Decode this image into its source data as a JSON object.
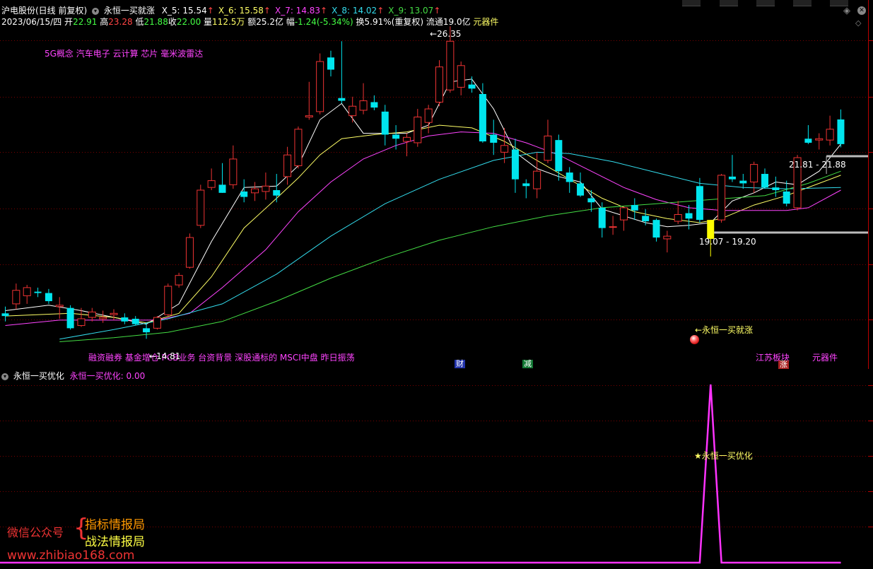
{
  "header": {
    "stock": "沪电股份(日线 前复权)",
    "indicator": "永恒一买就涨",
    "ma_items": [
      {
        "label": "X_5:",
        "value": "15.54",
        "color": "#ffffff"
      },
      {
        "label": "X_6:",
        "value": "15.58",
        "color": "#ffff66"
      },
      {
        "label": "X_7:",
        "value": "14.83",
        "color": "#ff44ff"
      },
      {
        "label": "X_8:",
        "value": "14.02",
        "color": "#33ddee"
      },
      {
        "label": "X_9:",
        "value": "13.07",
        "color": "#44dd44"
      }
    ],
    "up_arrow": "↑"
  },
  "quote": {
    "date": "2023/06/15/四",
    "open_label": "开",
    "open": "22.91",
    "high_label": "高",
    "high": "23.28",
    "low_label": "低",
    "low": "21.88",
    "close_label": "收",
    "close": "22.00",
    "vol_label": "量",
    "vol": "112.5万",
    "amt_label": "额",
    "amt": "25.2亿",
    "chg_label": "幅",
    "chg": "-1.24(-5.34%)",
    "turnover": "换5.91%(重复权)",
    "float": "流通19.0亿",
    "sector": "元器件"
  },
  "concepts_top": "5G概念 汽车电子 云计算 芯片 毫米波雷达",
  "concepts_bottom": "融资融券 基金增仓 PCB业务 台资背景 深股通标的 MSCI中盘 昨日振荡",
  "annotations": {
    "peak_price": "26.35",
    "low_price": "14.81",
    "buy_signal": "←永恒一买就涨",
    "range_high": "21.81 - 21.88",
    "range_low": "19.07 - 19.20",
    "sector_tag": "江苏板块",
    "sector_tag2": "元器件",
    "badge_cai": "财",
    "badge_jian": "减",
    "badge_zhang": "涨"
  },
  "sub": {
    "name": "永恒一买优化",
    "line_label": "永恒一买优化: 0.00",
    "signal_label": "★永恒一买优化"
  },
  "watermark": {
    "wechat": "微信公众号",
    "brace": "{",
    "line1": "指标情报局",
    "line2": "战法情报局",
    "url": "www.zhibiao168.com"
  },
  "colors": {
    "up": "#ee3333",
    "down": "#00e5ee",
    "signal_bar": "#ffff00",
    "ma5": "#ffffff",
    "ma6": "#ffff66",
    "ma7": "#ff44ff",
    "ma8": "#33ddee",
    "ma9": "#44dd44",
    "sub_line": "#ff33ff",
    "grid": "#7a0000"
  },
  "chart_data": {
    "type": "candlestick",
    "y_range": [
      13.8,
      26.8
    ],
    "candles": [
      {
        "o": 15.75,
        "h": 16.0,
        "l": 15.45,
        "c": 15.65
      },
      {
        "o": 16.1,
        "h": 16.85,
        "l": 15.9,
        "c": 16.6
      },
      {
        "o": 16.4,
        "h": 16.8,
        "l": 16.1,
        "c": 16.7
      },
      {
        "o": 16.55,
        "h": 16.7,
        "l": 16.35,
        "c": 16.5
      },
      {
        "o": 16.5,
        "h": 16.65,
        "l": 16.1,
        "c": 16.2
      },
      {
        "o": 16.0,
        "h": 16.35,
        "l": 15.55,
        "c": 16.05
      },
      {
        "o": 15.95,
        "h": 16.05,
        "l": 15.15,
        "c": 15.2
      },
      {
        "o": 15.3,
        "h": 15.95,
        "l": 15.25,
        "c": 15.55
      },
      {
        "o": 15.6,
        "h": 15.95,
        "l": 15.45,
        "c": 15.8
      },
      {
        "o": 15.55,
        "h": 15.85,
        "l": 15.4,
        "c": 15.6
      },
      {
        "o": 15.7,
        "h": 15.9,
        "l": 15.5,
        "c": 15.75
      },
      {
        "o": 15.6,
        "h": 15.75,
        "l": 15.35,
        "c": 15.45
      },
      {
        "o": 15.55,
        "h": 15.65,
        "l": 15.3,
        "c": 15.35
      },
      {
        "o": 15.2,
        "h": 15.4,
        "l": 14.81,
        "c": 15.05
      },
      {
        "o": 15.2,
        "h": 15.65,
        "l": 15.15,
        "c": 15.6
      },
      {
        "o": 15.7,
        "h": 16.85,
        "l": 15.65,
        "c": 16.75
      },
      {
        "o": 16.8,
        "h": 17.25,
        "l": 16.7,
        "c": 17.15
      },
      {
        "o": 17.45,
        "h": 18.7,
        "l": 17.4,
        "c": 18.55
      },
      {
        "o": 19.0,
        "h": 20.5,
        "l": 18.9,
        "c": 20.3
      },
      {
        "o": 20.4,
        "h": 21.1,
        "l": 20.3,
        "c": 20.65
      },
      {
        "o": 20.5,
        "h": 21.3,
        "l": 20.2,
        "c": 20.2
      },
      {
        "o": 20.5,
        "h": 21.95,
        "l": 20.35,
        "c": 21.45
      },
      {
        "o": 20.25,
        "h": 20.7,
        "l": 19.85,
        "c": 20.05
      },
      {
        "o": 20.2,
        "h": 20.6,
        "l": 19.9,
        "c": 20.35
      },
      {
        "o": 20.25,
        "h": 20.95,
        "l": 19.95,
        "c": 20.45
      },
      {
        "o": 20.3,
        "h": 20.9,
        "l": 19.85,
        "c": 20.1
      },
      {
        "o": 20.8,
        "h": 21.9,
        "l": 20.5,
        "c": 21.6
      },
      {
        "o": 21.2,
        "h": 22.65,
        "l": 21.1,
        "c": 22.55
      },
      {
        "o": 23.0,
        "h": 24.3,
        "l": 22.9,
        "c": 23.05
      },
      {
        "o": 23.2,
        "h": 25.35,
        "l": 23.1,
        "c": 25.05
      },
      {
        "o": 25.2,
        "h": 25.45,
        "l": 24.5,
        "c": 24.75
      },
      {
        "o": 23.7,
        "h": 25.8,
        "l": 23.5,
        "c": 23.6
      },
      {
        "o": 23.05,
        "h": 23.75,
        "l": 22.8,
        "c": 23.4
      },
      {
        "o": 23.25,
        "h": 24.25,
        "l": 23.1,
        "c": 23.6
      },
      {
        "o": 23.55,
        "h": 23.8,
        "l": 23.25,
        "c": 23.35
      },
      {
        "o": 23.2,
        "h": 23.45,
        "l": 21.95,
        "c": 22.35
      },
      {
        "o": 22.35,
        "h": 22.7,
        "l": 21.8,
        "c": 22.2
      },
      {
        "o": 22.1,
        "h": 22.4,
        "l": 21.55,
        "c": 22.25
      },
      {
        "o": 22.05,
        "h": 23.3,
        "l": 21.9,
        "c": 23.0
      },
      {
        "o": 22.8,
        "h": 23.45,
        "l": 22.4,
        "c": 23.3
      },
      {
        "o": 23.55,
        "h": 25.1,
        "l": 23.4,
        "c": 24.85
      },
      {
        "o": 24.0,
        "h": 26.35,
        "l": 23.9,
        "c": 25.8
      },
      {
        "o": 24.1,
        "h": 25.05,
        "l": 23.8,
        "c": 24.9
      },
      {
        "o": 24.2,
        "h": 24.5,
        "l": 23.9,
        "c": 24.05
      },
      {
        "o": 23.85,
        "h": 24.25,
        "l": 22.05,
        "c": 22.1
      },
      {
        "o": 22.35,
        "h": 22.9,
        "l": 21.6,
        "c": 22.05
      },
      {
        "o": 21.7,
        "h": 22.6,
        "l": 21.3,
        "c": 21.95
      },
      {
        "o": 21.8,
        "h": 22.2,
        "l": 20.2,
        "c": 20.7
      },
      {
        "o": 20.55,
        "h": 20.7,
        "l": 20.0,
        "c": 20.45
      },
      {
        "o": 20.35,
        "h": 21.7,
        "l": 20.0,
        "c": 21.0
      },
      {
        "o": 21.4,
        "h": 22.9,
        "l": 21.3,
        "c": 22.3
      },
      {
        "o": 22.15,
        "h": 22.35,
        "l": 20.65,
        "c": 21.0
      },
      {
        "o": 20.95,
        "h": 21.15,
        "l": 20.2,
        "c": 20.6
      },
      {
        "o": 20.55,
        "h": 20.95,
        "l": 20.05,
        "c": 20.1
      },
      {
        "o": 20.0,
        "h": 20.3,
        "l": 19.5,
        "c": 19.85
      },
      {
        "o": 19.65,
        "h": 19.85,
        "l": 18.55,
        "c": 18.9
      },
      {
        "o": 18.95,
        "h": 19.35,
        "l": 18.65,
        "c": 18.95
      },
      {
        "o": 19.2,
        "h": 19.7,
        "l": 18.8,
        "c": 19.65
      },
      {
        "o": 19.75,
        "h": 20.0,
        "l": 19.2,
        "c": 19.55
      },
      {
        "o": 19.35,
        "h": 19.6,
        "l": 19.0,
        "c": 19.15
      },
      {
        "o": 19.2,
        "h": 19.25,
        "l": 18.4,
        "c": 18.55
      },
      {
        "o": 18.5,
        "h": 18.8,
        "l": 18.0,
        "c": 18.6
      },
      {
        "o": 19.15,
        "h": 19.9,
        "l": 19.05,
        "c": 19.4
      },
      {
        "o": 19.45,
        "h": 19.75,
        "l": 18.85,
        "c": 19.25
      },
      {
        "o": 20.45,
        "h": 20.75,
        "l": 19.1,
        "c": 19.2
      },
      {
        "o": 19.2,
        "h": 19.2,
        "l": 17.85,
        "c": 18.5
      },
      {
        "o": 19.2,
        "h": 20.9,
        "l": 19.1,
        "c": 20.85
      },
      {
        "o": 20.8,
        "h": 21.6,
        "l": 20.6,
        "c": 20.7
      },
      {
        "o": 20.65,
        "h": 20.9,
        "l": 20.35,
        "c": 20.55
      },
      {
        "o": 20.6,
        "h": 21.35,
        "l": 20.2,
        "c": 21.25
      },
      {
        "o": 20.9,
        "h": 21.1,
        "l": 20.35,
        "c": 20.4
      },
      {
        "o": 20.4,
        "h": 20.8,
        "l": 20.05,
        "c": 20.3
      },
      {
        "o": 20.25,
        "h": 20.65,
        "l": 19.7,
        "c": 19.8
      },
      {
        "o": 19.65,
        "h": 21.6,
        "l": 19.55,
        "c": 21.5
      },
      {
        "o": 22.2,
        "h": 22.7,
        "l": 22.0,
        "c": 22.05
      },
      {
        "o": 22.15,
        "h": 22.4,
        "l": 21.8,
        "c": 22.2
      },
      {
        "o": 22.15,
        "h": 23.05,
        "l": 21.95,
        "c": 22.55
      },
      {
        "o": 22.91,
        "h": 23.28,
        "l": 21.88,
        "c": 22.0
      }
    ],
    "special_bar_index": 65,
    "peak_index": 41,
    "low_index": 13,
    "ma_lines": [
      {
        "name": "X_5",
        "color": "#ffffff",
        "points": [
          [
            0,
            15.85
          ],
          [
            4,
            16.05
          ],
          [
            7,
            15.85
          ],
          [
            10,
            15.6
          ],
          [
            13,
            15.35
          ],
          [
            16,
            16.1
          ],
          [
            19,
            18.4
          ],
          [
            22,
            20.4
          ],
          [
            25,
            20.45
          ],
          [
            27,
            21.2
          ],
          [
            29,
            22.9
          ],
          [
            31,
            23.5
          ],
          [
            33,
            22.4
          ],
          [
            35,
            22.4
          ],
          [
            37,
            22.4
          ],
          [
            39,
            22.7
          ],
          [
            41,
            24.3
          ],
          [
            43,
            24.4
          ],
          [
            45,
            23.3
          ],
          [
            47,
            21.7
          ],
          [
            49,
            21.1
          ],
          [
            51,
            20.8
          ],
          [
            53,
            20.6
          ],
          [
            55,
            19.6
          ],
          [
            57,
            19.35
          ],
          [
            59,
            19.1
          ],
          [
            61,
            18.95
          ],
          [
            63,
            19.0
          ],
          [
            65,
            19.1
          ],
          [
            67,
            19.9
          ],
          [
            69,
            20.2
          ],
          [
            71,
            20.6
          ],
          [
            73,
            20.5
          ],
          [
            75,
            21.0
          ],
          [
            77,
            22.0
          ]
        ]
      },
      {
        "name": "X_6",
        "color": "#ffff66",
        "points": [
          [
            0,
            15.65
          ],
          [
            6,
            15.75
          ],
          [
            10,
            15.6
          ],
          [
            13,
            15.4
          ],
          [
            16,
            15.75
          ],
          [
            19,
            17.1
          ],
          [
            22,
            18.9
          ],
          [
            25,
            20.0
          ],
          [
            27,
            20.75
          ],
          [
            29,
            21.6
          ],
          [
            31,
            22.2
          ],
          [
            34,
            22.35
          ],
          [
            37,
            22.45
          ],
          [
            40,
            22.7
          ],
          [
            43,
            22.6
          ],
          [
            46,
            22.1
          ],
          [
            49,
            21.4
          ],
          [
            52,
            20.7
          ],
          [
            55,
            20.0
          ],
          [
            58,
            19.5
          ],
          [
            61,
            19.25
          ],
          [
            64,
            19.1
          ],
          [
            66,
            19.25
          ],
          [
            69,
            19.75
          ],
          [
            72,
            20.1
          ],
          [
            75,
            20.55
          ],
          [
            77,
            20.85
          ]
        ]
      },
      {
        "name": "X_7",
        "color": "#ff44ff",
        "points": [
          [
            0,
            15.3
          ],
          [
            5,
            15.5
          ],
          [
            10,
            15.5
          ],
          [
            14,
            15.5
          ],
          [
            17,
            15.75
          ],
          [
            20,
            16.7
          ],
          [
            24,
            18.1
          ],
          [
            27,
            19.5
          ],
          [
            30,
            20.6
          ],
          [
            33,
            21.45
          ],
          [
            36,
            21.95
          ],
          [
            39,
            22.3
          ],
          [
            42,
            22.45
          ],
          [
            45,
            22.4
          ],
          [
            48,
            22.05
          ],
          [
            51,
            21.6
          ],
          [
            54,
            21.0
          ],
          [
            57,
            20.4
          ],
          [
            60,
            19.95
          ],
          [
            63,
            19.65
          ],
          [
            66,
            19.55
          ],
          [
            69,
            19.55
          ],
          [
            72,
            19.55
          ],
          [
            74,
            19.65
          ],
          [
            77,
            20.3
          ]
        ]
      },
      {
        "name": "X_8",
        "color": "#33ddee",
        "points": [
          [
            5,
            14.8
          ],
          [
            10,
            15.15
          ],
          [
            15,
            15.55
          ],
          [
            20,
            16.1
          ],
          [
            25,
            17.2
          ],
          [
            30,
            18.6
          ],
          [
            35,
            19.8
          ],
          [
            40,
            20.7
          ],
          [
            45,
            21.4
          ],
          [
            49,
            21.7
          ],
          [
            52,
            21.65
          ],
          [
            56,
            21.35
          ],
          [
            60,
            20.95
          ],
          [
            64,
            20.55
          ],
          [
            68,
            20.4
          ],
          [
            72,
            20.35
          ],
          [
            77,
            20.4
          ]
        ]
      },
      {
        "name": "X_9",
        "color": "#44dd44",
        "points": [
          [
            5,
            14.7
          ],
          [
            10,
            14.85
          ],
          [
            15,
            15.05
          ],
          [
            20,
            15.45
          ],
          [
            25,
            16.2
          ],
          [
            30,
            17.05
          ],
          [
            35,
            17.8
          ],
          [
            40,
            18.45
          ],
          [
            45,
            18.95
          ],
          [
            50,
            19.35
          ],
          [
            55,
            19.65
          ],
          [
            60,
            19.8
          ],
          [
            65,
            19.95
          ],
          [
            70,
            20.1
          ],
          [
            74,
            20.55
          ],
          [
            77,
            21.0
          ]
        ]
      }
    ],
    "sub_indicator": {
      "name": "永恒一买优化",
      "values_nonzero": [
        {
          "index": 65,
          "value": 1
        }
      ],
      "default": 0
    }
  }
}
